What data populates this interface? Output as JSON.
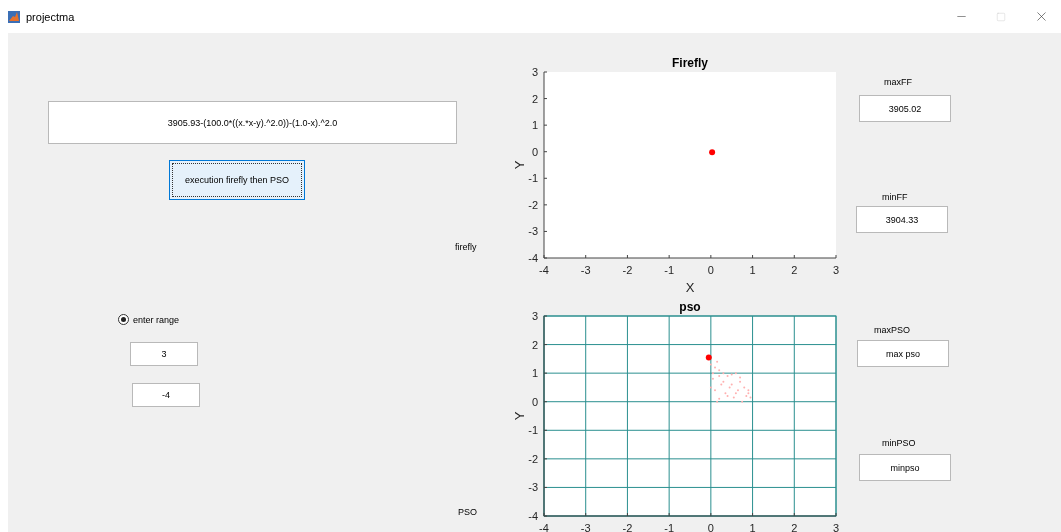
{
  "window": {
    "title": "projectma"
  },
  "function_field": {
    "value": "3905.93-(100.0*((x.*x-y).^2.0))-(1.0-x).^2.0"
  },
  "run_button": {
    "label": "execution firefly then PSO"
  },
  "firefly_label": "firefly",
  "range": {
    "label": "enter range",
    "selected": true,
    "upper": "3",
    "lower": "-4"
  },
  "pso_label": "PSO",
  "charts": [
    {
      "chart_data": {
        "type": "scatter",
        "title": "Firefly",
        "xlabel": "X",
        "ylabel": "Y",
        "xlim": [
          -4,
          3
        ],
        "ylim": [
          -4,
          3
        ],
        "xticks": [
          -4,
          -3,
          -2,
          -1,
          0,
          1,
          2,
          3
        ],
        "yticks": [
          -4,
          -3,
          -2,
          -1,
          0,
          1,
          2,
          3
        ],
        "series": [
          {
            "color": "#ff0000",
            "x": [
              0.03
            ],
            "values": [
              -0.02
            ]
          }
        ]
      }
    },
    {
      "chart_data": {
        "type": "scatter",
        "title": "pso",
        "ylabel": "Y",
        "grid": true,
        "xlim": [
          -4,
          3
        ],
        "ylim": [
          -4,
          3
        ],
        "xticks": [
          -4,
          -3,
          -2,
          -1,
          0,
          1,
          2,
          3
        ],
        "yticks": [
          -4,
          -3,
          -2,
          -1,
          0,
          1,
          2,
          3
        ],
        "series": [
          {
            "color": "#ff0000",
            "x": [
              -0.05
            ],
            "values": [
              1.55
            ]
          }
        ]
      }
    }
  ],
  "results": [
    {
      "label": "maxFF",
      "value": "3905.02"
    },
    {
      "label": "minFF",
      "value": "3904.33"
    },
    {
      "label": "maxPSO",
      "value": "max pso"
    },
    {
      "label": "minPSO",
      "value": "minpso"
    }
  ]
}
